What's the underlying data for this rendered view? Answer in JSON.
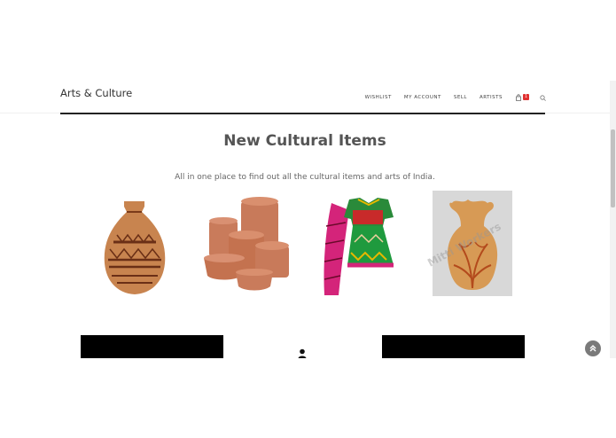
{
  "header": {
    "brand": "Arts & Culture",
    "nav": [
      "WISHLIST",
      "MY ACCOUNT",
      "SELL",
      "ARTISTS"
    ],
    "cart_count": "1",
    "search_icon": "search-icon",
    "cart_icon": "shopping-bag-icon"
  },
  "section": {
    "title": "New Cultural Items",
    "subtitle": "All in one place to find out all the cultural items and arts of India."
  },
  "products": [
    {
      "name": "terracotta-vase"
    },
    {
      "name": "clay-pots-stack"
    },
    {
      "name": "embroidered-dress"
    },
    {
      "name": "painted-vase",
      "watermark": "Mitti Workers"
    }
  ],
  "colors": {
    "accent": "#e03030",
    "title": "#555555",
    "clay": "#c8744f"
  }
}
